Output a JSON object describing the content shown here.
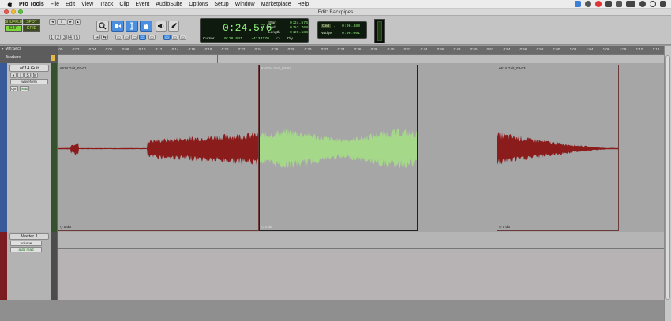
{
  "menubar": {
    "items": [
      "Pro Tools",
      "File",
      "Edit",
      "View",
      "Track",
      "Clip",
      "Event",
      "AudioSuite",
      "Options",
      "Setup",
      "Window",
      "Marketplace",
      "Help"
    ]
  },
  "window": {
    "title": "Edit: Backpipes"
  },
  "toolbar": {
    "shuffle": "SHUFFLE",
    "spot": "SPOT",
    "slip": "SLIP",
    "grid": "GRID",
    "zoom_presets": [
      "1",
      "2",
      "3",
      "4",
      "5"
    ]
  },
  "counter": {
    "main": "0:24.576",
    "start_label": "Start",
    "start": "0:24.576",
    "end_label": "End",
    "end": "0:53.760",
    "length_label": "Length",
    "length": "0:29.184",
    "cursor_label": "Cursor",
    "cursor": "0:18.541",
    "sample": "-4133170",
    "dly_label": "Dly"
  },
  "grid_nudge": {
    "grid_label": "Grid",
    "grid_value": "0:00.480",
    "nudge_label": "Nudge",
    "nudge_value": "0:00.001"
  },
  "ruler": {
    "label": "Min:Secs",
    "markers_label": "Markers",
    "ticks": [
      "0:00",
      "0:02",
      "0:04",
      "0:06",
      "0:08",
      "0:10",
      "0:12",
      "0:14",
      "0:16",
      "0:18",
      "0:20",
      "0:22",
      "0:24",
      "0:26",
      "0:28",
      "0:30",
      "0:32",
      "0:34",
      "0:36",
      "0:38",
      "0:40",
      "0:42",
      "0:44",
      "0:46",
      "0:48",
      "0:50",
      "0:52",
      "0:54",
      "0:56",
      "0:58",
      "1:00",
      "1:02",
      "1:04",
      "1:06",
      "1:08",
      "1:10",
      "1:12"
    ]
  },
  "track1": {
    "name": "e614 Guit",
    "view": "waveform",
    "dyn": "dyn",
    "read": "read",
    "clips": [
      {
        "name": "e614 Guit_03-01",
        "gain": "0 dB",
        "color": "#e3a9a9",
        "wave": "#8b1c1c"
      },
      {
        "name": "KM184 Guit_03-02",
        "gain": "0 dB",
        "color": "#3e4637",
        "wave": "#a6d88a"
      },
      {
        "name": "e614 Guit_03-03",
        "gain": "0 dB",
        "color": "#e3a9a9",
        "wave": "#8b1c1c"
      }
    ]
  },
  "track2": {
    "name": "Master 1",
    "view": "volume",
    "auto": "auto read"
  }
}
